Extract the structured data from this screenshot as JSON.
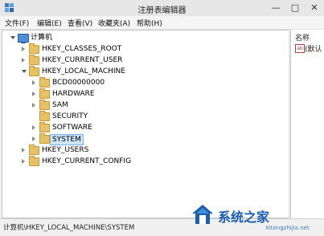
{
  "window": {
    "title": "注册表编辑器",
    "buttons": {
      "minimize": "—",
      "maximize": "□",
      "close": "✕"
    }
  },
  "menu": {
    "file": "文件(F)",
    "edit": "编辑(E)",
    "view": "查看(V)",
    "favorites": "收藏夹(A)",
    "help": "帮助(H)"
  },
  "tree": {
    "root": "计算机",
    "hkcr": "HKEY_CLASSES_ROOT",
    "hkcu": "HKEY_CURRENT_USER",
    "hklm": "HKEY_LOCAL_MACHINE",
    "bcd": "BCD00000000",
    "hardware": "HARDWARE",
    "sam": "SAM",
    "security": "SECURITY",
    "software": "SOFTWARE",
    "system": "SYSTEM",
    "hku": "HKEY_USERS",
    "hkcc": "HKEY_CURRENT_CONFIG"
  },
  "values_pane": {
    "header_name": "名称",
    "row_icon": "ab",
    "row_name": "(默认"
  },
  "status": {
    "path": "计算机\\HKEY_LOCAL_MACHINE\\SYSTEM"
  },
  "watermark": {
    "brand": "系统之家",
    "url": "Xitongzhijia.net"
  },
  "colors": {
    "folder": "#e8c065",
    "selection": "#cce4f7",
    "brand_blue": "#1b5fb0"
  }
}
